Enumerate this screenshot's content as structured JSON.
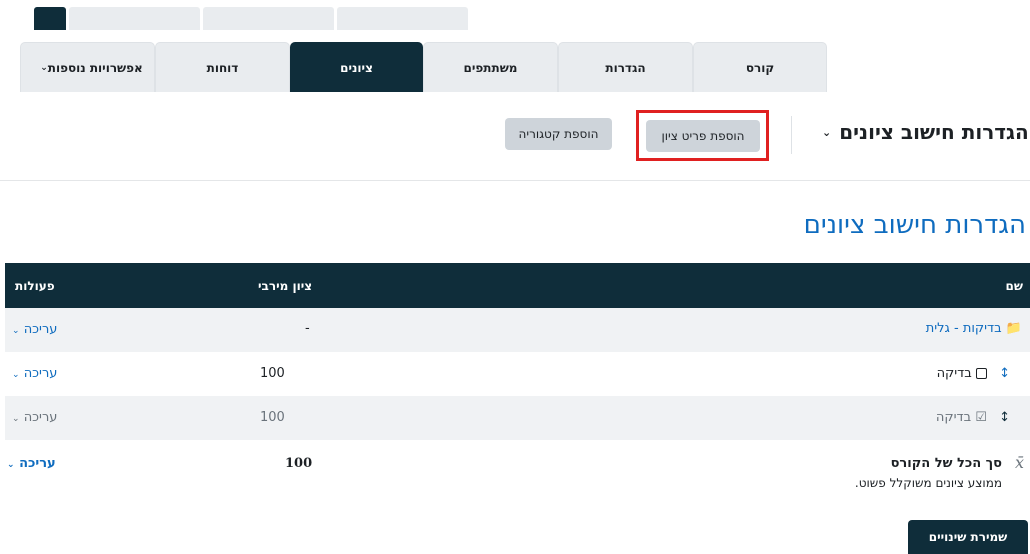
{
  "tabs": [
    {
      "label": "אפשרויות נוספות",
      "has_menu": true
    },
    {
      "label": "דוחות"
    },
    {
      "label": "ציונים",
      "active": true
    },
    {
      "label": "משתתפים"
    },
    {
      "label": "הגדרות"
    },
    {
      "label": "קורס"
    }
  ],
  "toolbar": {
    "page_select": "הגדרות חישוב ציונים",
    "add_grade_item": "הוספת פריט ציון",
    "add_category": "הוספת קטגוריה"
  },
  "heading": "הגדרות חישוב ציונים",
  "table": {
    "col_name": "שם",
    "col_max": "ציון מירבי",
    "col_actions": "פעולות",
    "rows": [
      {
        "name": "בדיקות - גלית",
        "max": "-",
        "action": "עריכה",
        "type": "category"
      },
      {
        "name": "בדיקה",
        "max": "100",
        "action": "עריכה",
        "type": "item"
      },
      {
        "name": "בדיקה",
        "max": "100",
        "action": "עריכה",
        "type": "item-hidden"
      },
      {
        "name": "סך הכל של הקורס",
        "sub": "ממוצע ציונים משוקלל פשוט.",
        "max": "100",
        "action": "עריכה",
        "type": "total"
      }
    ]
  },
  "save_label": "שמירת שינויים",
  "colors": {
    "primary": "#0f2d3a",
    "link": "#0f6cbf",
    "highlight": "#e02020"
  }
}
